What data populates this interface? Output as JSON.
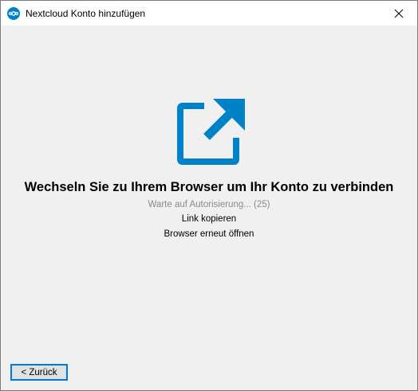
{
  "window": {
    "title": "Nextcloud Konto hinzufügen"
  },
  "main": {
    "headline": "Wechseln Sie zu Ihrem Browser um Ihr Konto zu verbinden",
    "status": "Warte auf Autorisierung... (25)",
    "copy_link_label": "Link kopieren",
    "reopen_browser_label": "Browser erneut öffnen"
  },
  "footer": {
    "back_label": "< Zurück"
  },
  "colors": {
    "accent": "#0082c9",
    "background": "#f0f0f0",
    "status_text": "#8a8a8a",
    "focus_border": "#0078d7"
  },
  "icons": {
    "app": "nextcloud-logo-icon",
    "hero": "open-external-icon",
    "close": "close-icon"
  }
}
